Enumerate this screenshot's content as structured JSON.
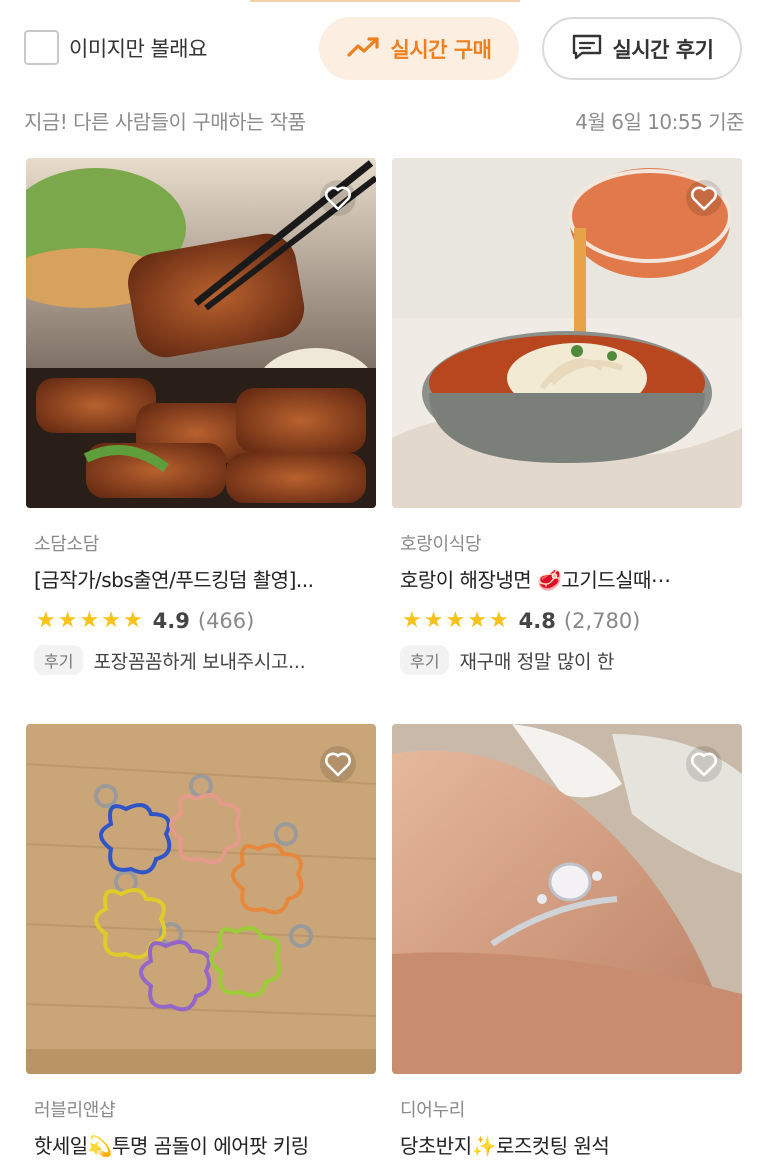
{
  "toolbar": {
    "image_only_label": "이미지만 볼래요",
    "realtime_buy_label": "실시간 구매",
    "realtime_review_label": "실시간 후기"
  },
  "subheader": {
    "left": "지금! 다른 사람들이 구매하는 작품",
    "right": "4월 6일 10:55 기준"
  },
  "products": [
    {
      "shop": "소담소담",
      "title": "[금작가/sbs출연/푸드킹덤 촬영]...",
      "rating": "4.9",
      "reviews": "(466)",
      "review_badge": "후기",
      "review_text": "포장꼼꼼하게  보내주시고...",
      "image": "grilled-galbi-photo"
    },
    {
      "shop": "호랑이식당",
      "title": "호랑이 해장냉면 🥩고기드실때⋯",
      "rating": "4.8",
      "reviews": "(2,780)",
      "review_badge": "후기",
      "review_text": "재구매 정말 많이 한",
      "image": "cold-noodle-photo"
    },
    {
      "shop": "러블리앤샵",
      "title": "핫세일💫투명 곰돌이 에어팟 키링",
      "image": "bear-keyring-photo"
    },
    {
      "shop": "디어누리",
      "title": "당초반지✨로즈컷팅 원석",
      "image": "ring-photo"
    }
  ],
  "colors": {
    "accent": "#f07f1e",
    "star": "#f8c21c"
  }
}
